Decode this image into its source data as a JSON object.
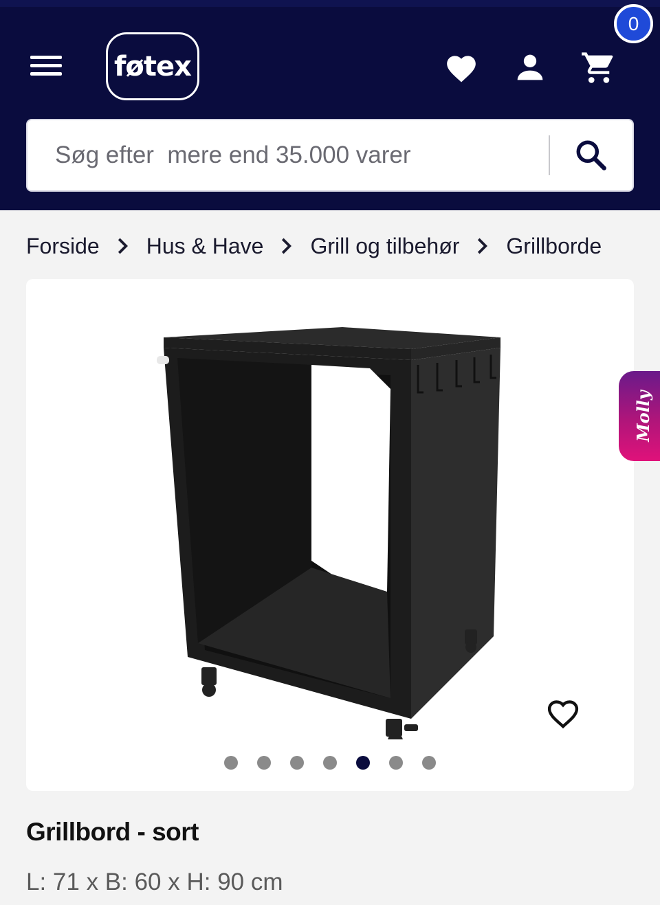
{
  "header": {
    "logo_text": "føtex",
    "cart_count": "0",
    "bg_color": "#0a0c3e"
  },
  "search": {
    "placeholder": "Søg efter  mere end 35.000 varer"
  },
  "breadcrumb": [
    "Forside",
    "Hus & Have",
    "Grill og tilbehør",
    "Grillborde"
  ],
  "gallery": {
    "slide_count": 7,
    "active_index": 4
  },
  "chat_widget": {
    "label": "Molly"
  },
  "product": {
    "title": "Grillbord - sort",
    "dimensions": "L: 71 x B: 60 x H: 90 cm"
  },
  "icons": [
    "menu-icon",
    "heart-icon",
    "user-icon",
    "cart-icon",
    "search-icon",
    "chevron-right-icon",
    "heart-outline-icon"
  ]
}
